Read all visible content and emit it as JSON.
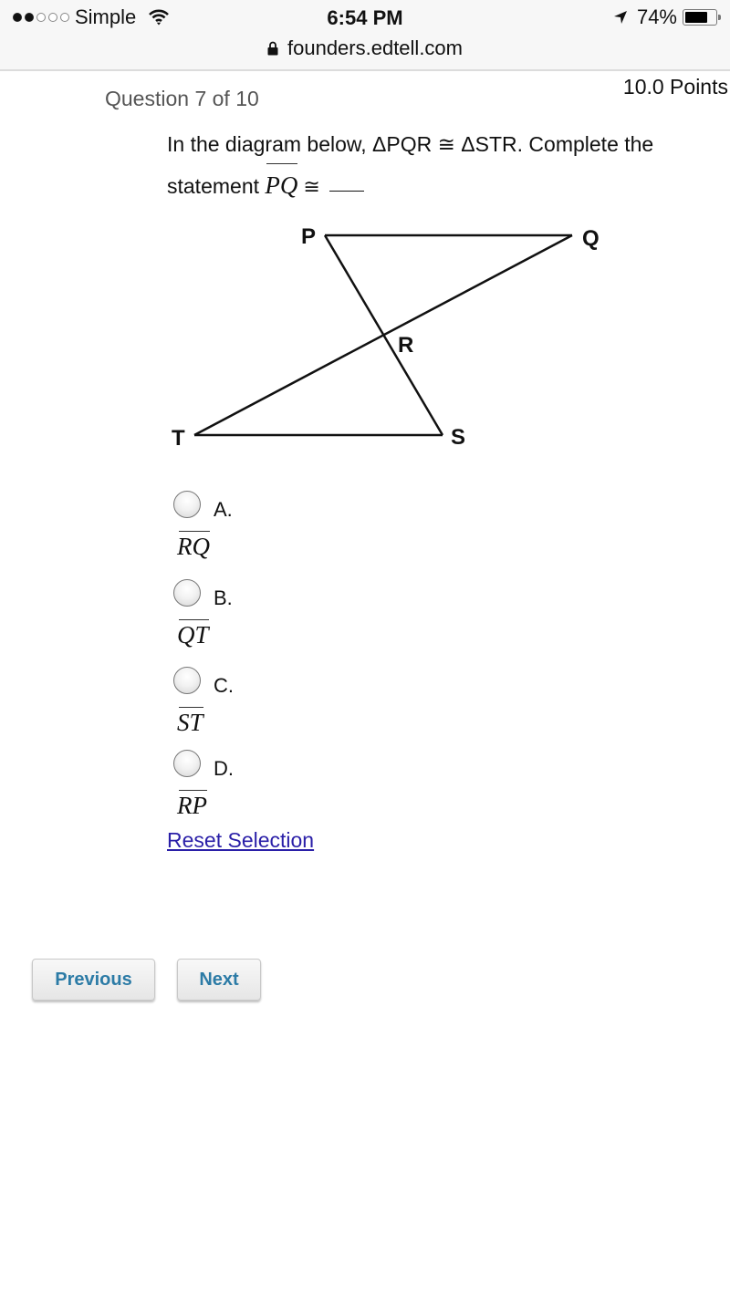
{
  "status_bar": {
    "signal_dots_filled": 2,
    "signal_dots_total": 5,
    "carrier": "Simple",
    "wifi_icon": "wifi-icon",
    "time": "6:54 PM",
    "location_icon": "location-arrow-icon",
    "battery_percent_label": "74%",
    "battery_level": 0.74,
    "url": "founders.edtell.com",
    "lock_icon": "lock-icon"
  },
  "question": {
    "number_label": "Question 7 of 10",
    "points_label": "10.0 Points",
    "text_line1": "In the diagram below, ΔPQR ≅ ΔSTR. Complete the",
    "text_line2_prefix": "statement",
    "segment": "PQ",
    "congruent_symbol": "≅"
  },
  "diagram": {
    "labels": {
      "P": "P",
      "Q": "Q",
      "R": "R",
      "S": "S",
      "T": "T"
    }
  },
  "choices": [
    {
      "letter": "A.",
      "segment": "RQ",
      "selected": false
    },
    {
      "letter": "B.",
      "segment": "QT",
      "selected": false
    },
    {
      "letter": "C.",
      "segment": "ST",
      "selected": false
    },
    {
      "letter": "D.",
      "segment": "RP",
      "selected": false
    }
  ],
  "reset_label": "Reset Selection",
  "nav": {
    "previous_label": "Previous",
    "next_label": "Next"
  },
  "colors": {
    "link": "#2a1fa8",
    "button_text": "#2c7ba6"
  }
}
